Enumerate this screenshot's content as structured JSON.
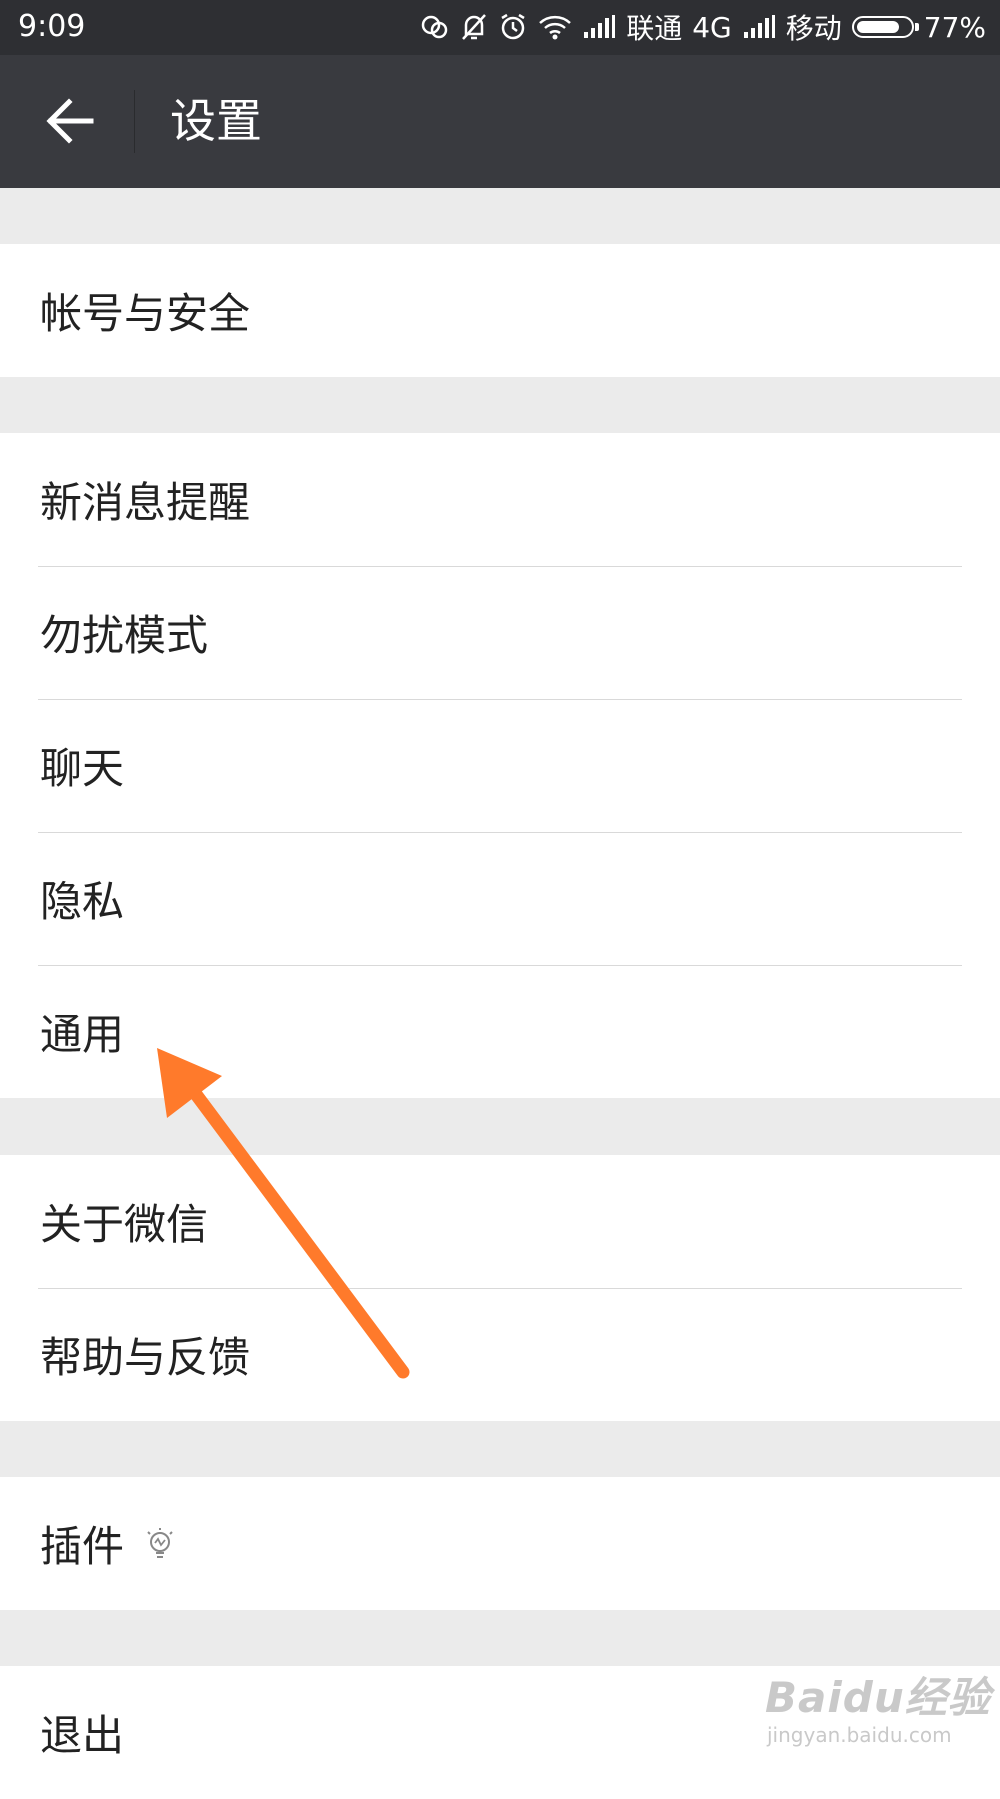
{
  "status_bar": {
    "time": "9:09",
    "carrier1": "联通",
    "network": "4G",
    "carrier2": "移动",
    "battery": "77%",
    "battery_level": 0.77
  },
  "app_bar": {
    "back_icon": "arrow-left-icon",
    "title": "设置"
  },
  "sections": [
    {
      "items": [
        {
          "label": "帐号与安全"
        }
      ]
    },
    {
      "items": [
        {
          "label": "新消息提醒"
        },
        {
          "label": "勿扰模式"
        },
        {
          "label": "聊天"
        },
        {
          "label": "隐私"
        },
        {
          "label": "通用"
        }
      ]
    },
    {
      "items": [
        {
          "label": "关于微信"
        },
        {
          "label": "帮助与反馈"
        }
      ]
    },
    {
      "items": [
        {
          "label": "插件",
          "icon": "lightbulb-icon"
        }
      ]
    },
    {
      "items": [
        {
          "label": "退出"
        }
      ]
    }
  ],
  "annotation": {
    "color": "#ff7a2b",
    "points_to": "通用"
  },
  "watermark": {
    "logo": "Baidu经验",
    "url": "jingyan.baidu.com"
  },
  "colors": {
    "status_bar": "#2e2f33",
    "app_bar": "#393a3f",
    "background": "#ebebeb",
    "row": "#ffffff"
  }
}
